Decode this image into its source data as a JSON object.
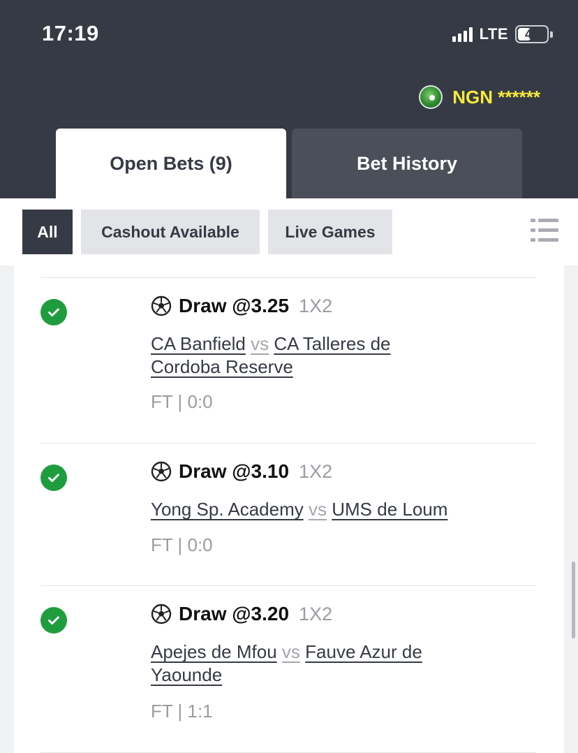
{
  "status_bar": {
    "time": "17:19",
    "network": "LTE",
    "battery": "44"
  },
  "account": {
    "balance": "NGN ******"
  },
  "tabs": {
    "open_bets": "Open Bets (9)",
    "bet_history": "Bet History"
  },
  "filters": {
    "all": "All",
    "cashout": "Cashout Available",
    "live": "Live Games"
  },
  "bets": [
    {
      "pick": "Draw @3.25",
      "market": "1X2",
      "home": "CA Banfield",
      "vs": "vs",
      "away": "CA Talleres de Cordoba Reserve",
      "result": "FT | 0:0"
    },
    {
      "pick": "Draw @3.10",
      "market": "1X2",
      "home": "Yong Sp. Academy",
      "vs": "vs",
      "away": "UMS de Loum",
      "result": "FT | 0:0"
    },
    {
      "pick": "Draw @3.20",
      "market": "1X2",
      "home": "Apejes de Mfou",
      "vs": "vs",
      "away": "Fauve Azur de Yaounde",
      "result": "FT | 1:1"
    }
  ],
  "colors": {
    "header_bg": "#363a45",
    "balance": "#f5ea3a",
    "won_check": "#1f9d3e"
  },
  "icons": {
    "status": "check-circle-icon",
    "sport": "soccer-ball-icon",
    "list": "list-view-icon"
  }
}
